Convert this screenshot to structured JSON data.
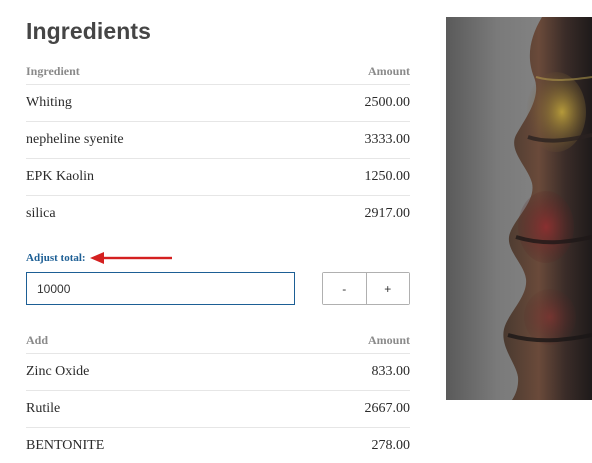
{
  "ingredients": {
    "title": "Ingredients",
    "header": {
      "name": "Ingredient",
      "amount": "Amount"
    },
    "rows": [
      {
        "name": "Whiting",
        "amount": "2500.00"
      },
      {
        "name": "nepheline syenite",
        "amount": "3333.00"
      },
      {
        "name": "EPK Kaolin",
        "amount": "1250.00"
      },
      {
        "name": "silica",
        "amount": "2917.00"
      }
    ]
  },
  "adjust": {
    "label": "Adjust total:",
    "value": "10000",
    "minus_label": "-",
    "plus_label": "+",
    "arrow_color": "#d42020"
  },
  "additions": {
    "header": {
      "name": "Add",
      "amount": "Amount"
    },
    "rows": [
      {
        "name": "Zinc Oxide",
        "amount": "833.00"
      },
      {
        "name": "Rutile",
        "amount": "2667.00"
      },
      {
        "name": "BENTONITE",
        "amount": "278.00"
      }
    ]
  },
  "colors": {
    "accent": "#1d5f95",
    "arrow": "#d42020"
  }
}
